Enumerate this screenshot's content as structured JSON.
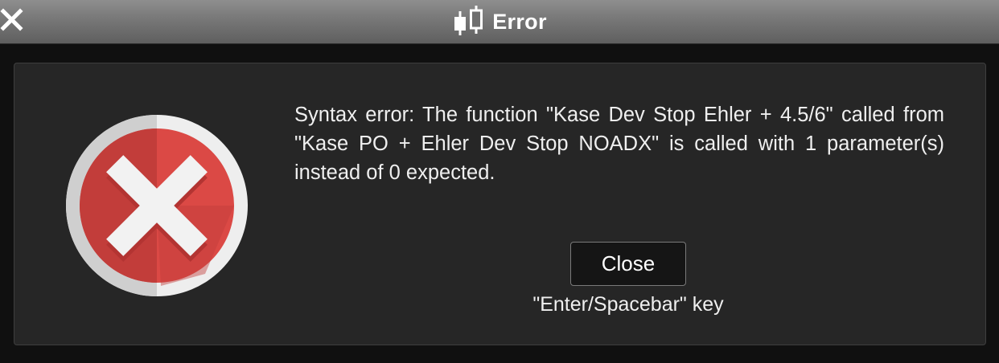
{
  "window": {
    "title": "Error",
    "close_icon": "close-x-icon",
    "title_icon": "candlestick-icon"
  },
  "dialog": {
    "icon": "error-circle-x-icon",
    "message": "Syntax error: The function \"Kase Dev Stop Ehler + 4.5/6\" called from \"Kase PO + Ehler Dev Stop NOADX\" is called with 1 parameter(s) instead of 0 expected.",
    "close_label": "Close",
    "close_hint": "\"Enter/Spacebar\" key"
  },
  "colors": {
    "titlebar": "#7a7a7a",
    "panel": "#262626",
    "icon_red": "#d9413f",
    "icon_ring": "#e6e6e6"
  }
}
